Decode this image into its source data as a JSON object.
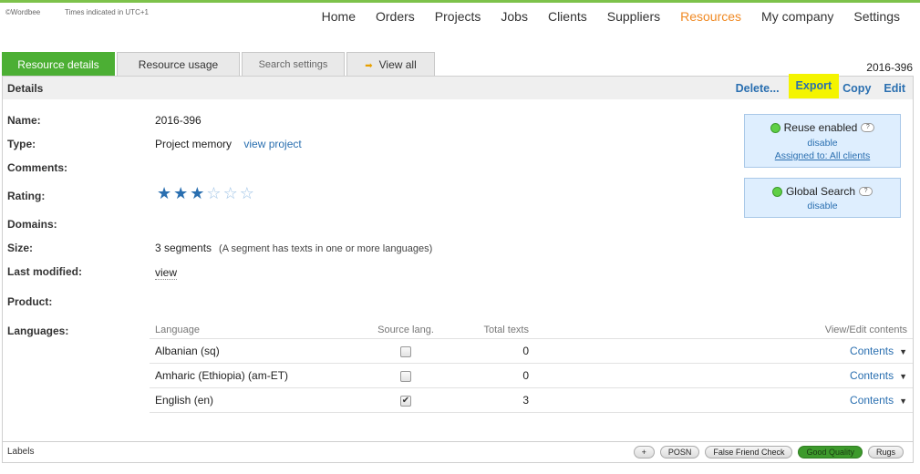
{
  "brand": "©Wordbee",
  "timezone_note": "Times indicated in UTC+1",
  "nav": [
    "Home",
    "Orders",
    "Projects",
    "Jobs",
    "Clients",
    "Suppliers",
    "Resources",
    "My company",
    "Settings"
  ],
  "nav_active": "Resources",
  "tabs": {
    "resource_details": "Resource details",
    "resource_usage": "Resource usage",
    "search_settings": "Search settings",
    "view_all": "View all"
  },
  "resource_id": "2016-396",
  "panel": {
    "title": "Details",
    "actions": {
      "delete": "Delete...",
      "export": "Export",
      "copy": "Copy",
      "edit": "Edit"
    }
  },
  "fields": {
    "name_label": "Name:",
    "name_value": "2016-396",
    "type_label": "Type:",
    "type_value": "Project memory",
    "type_link": "view project",
    "comments_label": "Comments:",
    "rating_label": "Rating:",
    "rating_value": 3,
    "rating_max": 6,
    "domains_label": "Domains:",
    "size_label": "Size:",
    "size_value": "3 segments",
    "size_note": "(A segment has texts in one or more languages)",
    "modified_label": "Last modified:",
    "modified_link": "view",
    "product_label": "Product:",
    "languages_label": "Languages:"
  },
  "reuse": {
    "label": "Reuse enabled",
    "disable": "disable",
    "assigned": "Assigned to: All clients"
  },
  "global_search": {
    "label": "Global Search",
    "disable": "disable"
  },
  "lang_table": {
    "headers": {
      "language": "Language",
      "source": "Source lang.",
      "total": "Total texts",
      "view": "View/Edit contents"
    },
    "rows": [
      {
        "language": "Albanian (sq)",
        "source": false,
        "total": "0",
        "contents": "Contents"
      },
      {
        "language": "Amharic (Ethiopia) (am-ET)",
        "source": false,
        "total": "0",
        "contents": "Contents"
      },
      {
        "language": "English (en)",
        "source": true,
        "total": "3",
        "contents": "Contents"
      }
    ]
  },
  "footer": {
    "labels_title": "Labels",
    "chips": [
      "+",
      "POSN",
      "False Friend Check",
      "Good Quality",
      "Rugs"
    ]
  }
}
